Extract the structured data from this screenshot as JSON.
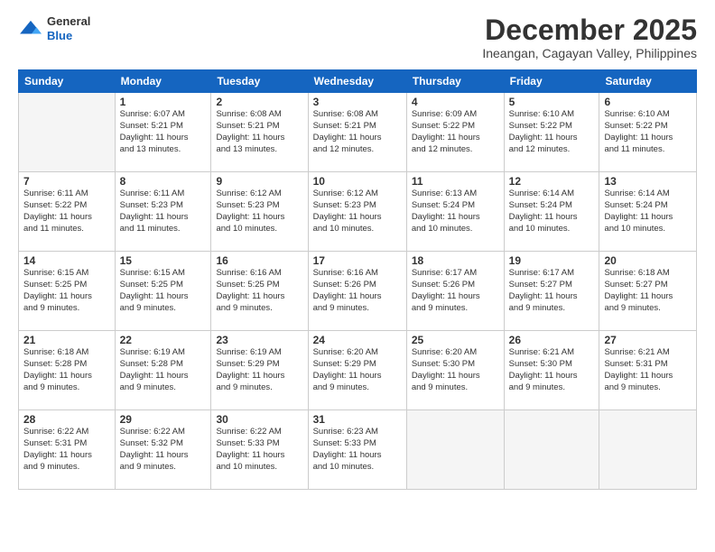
{
  "header": {
    "logo_general": "General",
    "logo_blue": "Blue",
    "month_title": "December 2025",
    "location": "Ineangan, Cagayan Valley, Philippines"
  },
  "weekdays": [
    "Sunday",
    "Monday",
    "Tuesday",
    "Wednesday",
    "Thursday",
    "Friday",
    "Saturday"
  ],
  "weeks": [
    [
      {
        "day": "",
        "info": ""
      },
      {
        "day": "1",
        "info": "Sunrise: 6:07 AM\nSunset: 5:21 PM\nDaylight: 11 hours\nand 13 minutes."
      },
      {
        "day": "2",
        "info": "Sunrise: 6:08 AM\nSunset: 5:21 PM\nDaylight: 11 hours\nand 13 minutes."
      },
      {
        "day": "3",
        "info": "Sunrise: 6:08 AM\nSunset: 5:21 PM\nDaylight: 11 hours\nand 12 minutes."
      },
      {
        "day": "4",
        "info": "Sunrise: 6:09 AM\nSunset: 5:22 PM\nDaylight: 11 hours\nand 12 minutes."
      },
      {
        "day": "5",
        "info": "Sunrise: 6:10 AM\nSunset: 5:22 PM\nDaylight: 11 hours\nand 12 minutes."
      },
      {
        "day": "6",
        "info": "Sunrise: 6:10 AM\nSunset: 5:22 PM\nDaylight: 11 hours\nand 11 minutes."
      }
    ],
    [
      {
        "day": "7",
        "info": "Sunrise: 6:11 AM\nSunset: 5:22 PM\nDaylight: 11 hours\nand 11 minutes."
      },
      {
        "day": "8",
        "info": "Sunrise: 6:11 AM\nSunset: 5:23 PM\nDaylight: 11 hours\nand 11 minutes."
      },
      {
        "day": "9",
        "info": "Sunrise: 6:12 AM\nSunset: 5:23 PM\nDaylight: 11 hours\nand 10 minutes."
      },
      {
        "day": "10",
        "info": "Sunrise: 6:12 AM\nSunset: 5:23 PM\nDaylight: 11 hours\nand 10 minutes."
      },
      {
        "day": "11",
        "info": "Sunrise: 6:13 AM\nSunset: 5:24 PM\nDaylight: 11 hours\nand 10 minutes."
      },
      {
        "day": "12",
        "info": "Sunrise: 6:14 AM\nSunset: 5:24 PM\nDaylight: 11 hours\nand 10 minutes."
      },
      {
        "day": "13",
        "info": "Sunrise: 6:14 AM\nSunset: 5:24 PM\nDaylight: 11 hours\nand 10 minutes."
      }
    ],
    [
      {
        "day": "14",
        "info": "Sunrise: 6:15 AM\nSunset: 5:25 PM\nDaylight: 11 hours\nand 9 minutes."
      },
      {
        "day": "15",
        "info": "Sunrise: 6:15 AM\nSunset: 5:25 PM\nDaylight: 11 hours\nand 9 minutes."
      },
      {
        "day": "16",
        "info": "Sunrise: 6:16 AM\nSunset: 5:25 PM\nDaylight: 11 hours\nand 9 minutes."
      },
      {
        "day": "17",
        "info": "Sunrise: 6:16 AM\nSunset: 5:26 PM\nDaylight: 11 hours\nand 9 minutes."
      },
      {
        "day": "18",
        "info": "Sunrise: 6:17 AM\nSunset: 5:26 PM\nDaylight: 11 hours\nand 9 minutes."
      },
      {
        "day": "19",
        "info": "Sunrise: 6:17 AM\nSunset: 5:27 PM\nDaylight: 11 hours\nand 9 minutes."
      },
      {
        "day": "20",
        "info": "Sunrise: 6:18 AM\nSunset: 5:27 PM\nDaylight: 11 hours\nand 9 minutes."
      }
    ],
    [
      {
        "day": "21",
        "info": "Sunrise: 6:18 AM\nSunset: 5:28 PM\nDaylight: 11 hours\nand 9 minutes."
      },
      {
        "day": "22",
        "info": "Sunrise: 6:19 AM\nSunset: 5:28 PM\nDaylight: 11 hours\nand 9 minutes."
      },
      {
        "day": "23",
        "info": "Sunrise: 6:19 AM\nSunset: 5:29 PM\nDaylight: 11 hours\nand 9 minutes."
      },
      {
        "day": "24",
        "info": "Sunrise: 6:20 AM\nSunset: 5:29 PM\nDaylight: 11 hours\nand 9 minutes."
      },
      {
        "day": "25",
        "info": "Sunrise: 6:20 AM\nSunset: 5:30 PM\nDaylight: 11 hours\nand 9 minutes."
      },
      {
        "day": "26",
        "info": "Sunrise: 6:21 AM\nSunset: 5:30 PM\nDaylight: 11 hours\nand 9 minutes."
      },
      {
        "day": "27",
        "info": "Sunrise: 6:21 AM\nSunset: 5:31 PM\nDaylight: 11 hours\nand 9 minutes."
      }
    ],
    [
      {
        "day": "28",
        "info": "Sunrise: 6:22 AM\nSunset: 5:31 PM\nDaylight: 11 hours\nand 9 minutes."
      },
      {
        "day": "29",
        "info": "Sunrise: 6:22 AM\nSunset: 5:32 PM\nDaylight: 11 hours\nand 9 minutes."
      },
      {
        "day": "30",
        "info": "Sunrise: 6:22 AM\nSunset: 5:33 PM\nDaylight: 11 hours\nand 10 minutes."
      },
      {
        "day": "31",
        "info": "Sunrise: 6:23 AM\nSunset: 5:33 PM\nDaylight: 11 hours\nand 10 minutes."
      },
      {
        "day": "",
        "info": ""
      },
      {
        "day": "",
        "info": ""
      },
      {
        "day": "",
        "info": ""
      }
    ]
  ]
}
